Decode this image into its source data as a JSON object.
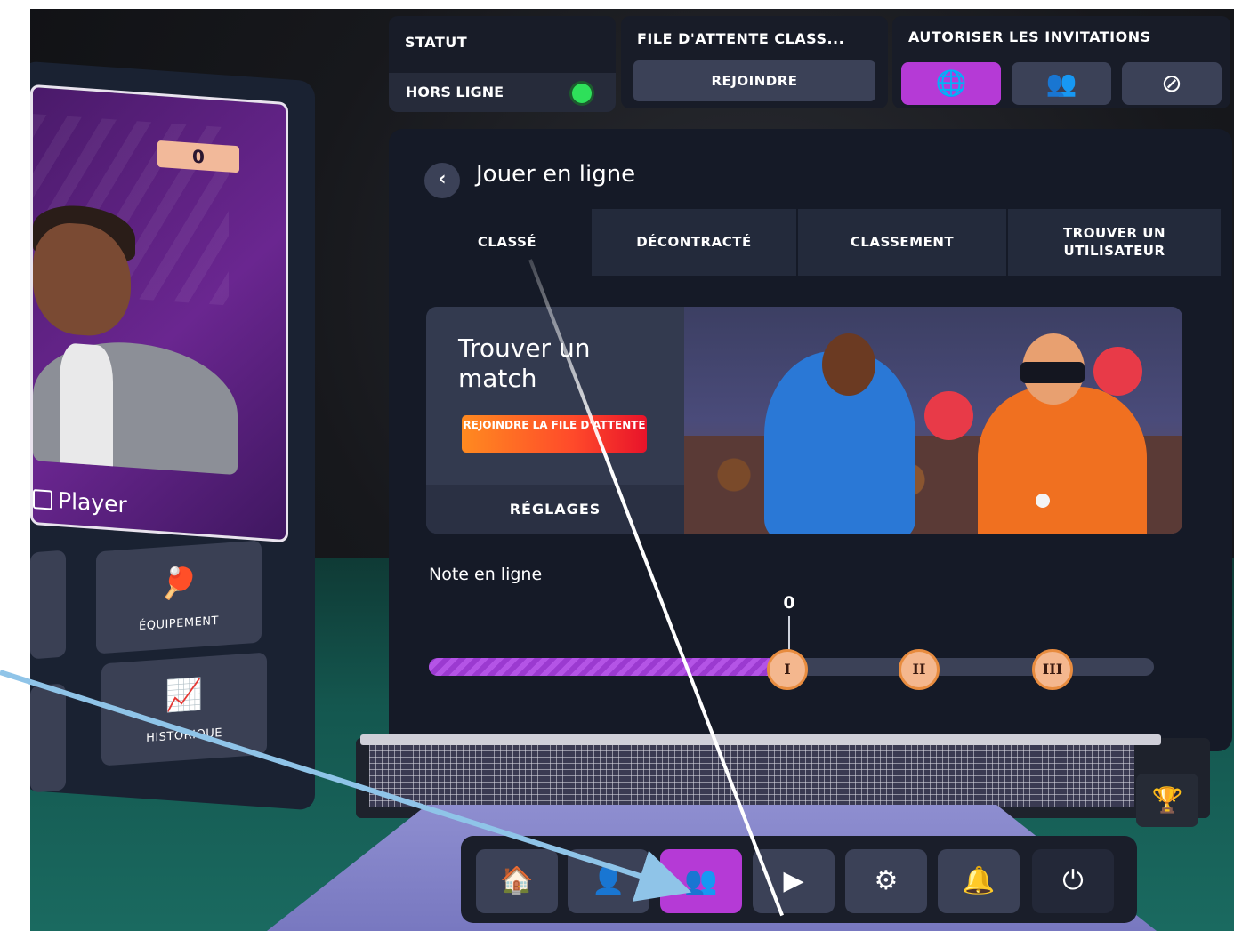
{
  "status_bar": {
    "status_title": "STATUT",
    "status_value": "HORS LIGNE",
    "queue_title": "FILE D'ATTENTE CLASS...",
    "queue_button": "REJOINDRE",
    "invites_title": "AUTORISER LES INVITATIONS",
    "invite_options": [
      {
        "icon": "globe-icon",
        "glyph": "🌐",
        "active": true
      },
      {
        "icon": "friends-icon",
        "glyph": "👥",
        "active": false
      },
      {
        "icon": "block-icon",
        "glyph": "⊘",
        "active": false
      }
    ]
  },
  "profile": {
    "score": "0",
    "player_name": "Player",
    "tiles": [
      {
        "label": "ÉQUIPEMENT",
        "icon": "paddle-icon",
        "glyph": "🏓"
      },
      {
        "label": "HISTORIQUE",
        "icon": "chart-icon",
        "glyph": "📈"
      }
    ]
  },
  "main": {
    "back_glyph": "‹",
    "title": "Jouer en ligne",
    "tabs": [
      "CLASSÉ",
      "DÉCONTRACTÉ",
      "CLASSEMENT",
      "TROUVER UN UTILISATEUR"
    ],
    "active_tab": 0,
    "match": {
      "title": "Trouver un match",
      "queue_button": "REJOINDRE LA FILE D'ATTENTE",
      "settings_button": "RÉGLAGES"
    },
    "rating": {
      "label": "Note en ligne",
      "value": "0",
      "progress_fraction": 0.48,
      "tiers": [
        "I",
        "II",
        "III"
      ]
    }
  },
  "dock": {
    "buttons": [
      {
        "name": "home",
        "icon": "home-icon",
        "glyph": "🏠",
        "active": false
      },
      {
        "name": "profile",
        "icon": "person-icon",
        "glyph": "👤",
        "active": false
      },
      {
        "name": "online",
        "icon": "multiplayer-icon",
        "glyph": "👥",
        "active": true
      },
      {
        "name": "tutorial",
        "icon": "map-play-icon",
        "glyph": "▶",
        "active": false
      },
      {
        "name": "settings",
        "icon": "gear-icon",
        "glyph": "⚙",
        "active": false
      },
      {
        "name": "notifications",
        "icon": "bell-icon",
        "glyph": "🔔",
        "active": false
      },
      {
        "name": "power",
        "icon": "power-icon",
        "glyph": "⏻",
        "active": false
      }
    ]
  },
  "net": {
    "trophy_glyph": "🏆"
  },
  "colors": {
    "accent_purple": "#b53ad6",
    "status_online": "#2ee05a",
    "queue_orange": "#ff6a20",
    "annotation_arrow": "#8fc4e8"
  }
}
